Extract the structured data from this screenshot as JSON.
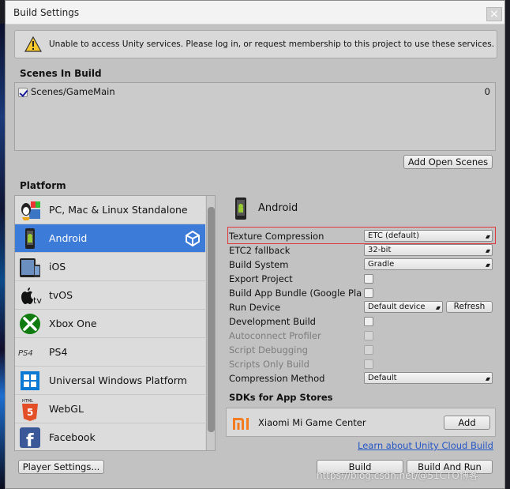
{
  "window": {
    "title": "Build Settings",
    "close_glyph": "×"
  },
  "warning": {
    "icon": "warning-triangle-icon",
    "message": "Unable to access Unity services. Please log in, or request membership to this project to use these services."
  },
  "scenes": {
    "header": "Scenes In Build",
    "items": [
      {
        "name": "Scenes/GameMain",
        "index": "0",
        "checked": true
      }
    ],
    "add_open_scenes_label": "Add Open Scenes"
  },
  "platform": {
    "header": "Platform",
    "items": [
      {
        "label": "PC, Mac & Linux Standalone",
        "icon": "standalone-icon",
        "selected": false
      },
      {
        "label": "Android",
        "icon": "android-icon",
        "selected": true
      },
      {
        "label": "iOS",
        "icon": "ios-icon",
        "selected": false
      },
      {
        "label": "tvOS",
        "icon": "tvos-icon",
        "selected": false
      },
      {
        "label": "Xbox One",
        "icon": "xbox-icon",
        "selected": false
      },
      {
        "label": "PS4",
        "icon": "ps4-icon",
        "selected": false
      },
      {
        "label": "Universal Windows Platform",
        "icon": "windows-icon",
        "selected": false
      },
      {
        "label": "WebGL",
        "icon": "html5-icon",
        "selected": false
      },
      {
        "label": "Facebook",
        "icon": "facebook-icon",
        "selected": false
      }
    ]
  },
  "selected_platform": {
    "title": "Android",
    "settings": {
      "texture_compression": {
        "label": "Texture Compression",
        "value": "ETC (default)"
      },
      "etc2_fallback": {
        "label": "ETC2 fallback",
        "value": "32-bit"
      },
      "build_system": {
        "label": "Build System",
        "value": "Gradle"
      },
      "export_project": {
        "label": "Export Project",
        "checked": false
      },
      "build_app_bundle": {
        "label": "Build App Bundle (Google Play)",
        "checked": false
      },
      "run_device": {
        "label": "Run Device",
        "value": "Default device",
        "refresh_label": "Refresh"
      },
      "development_build": {
        "label": "Development Build",
        "checked": false
      },
      "autoconnect_profiler": {
        "label": "Autoconnect Profiler",
        "checked": false,
        "enabled": false
      },
      "script_debugging": {
        "label": "Script Debugging",
        "checked": false,
        "enabled": false
      },
      "scripts_only_build": {
        "label": "Scripts Only Build",
        "checked": false,
        "enabled": false
      },
      "compression_method": {
        "label": "Compression Method",
        "value": "Default"
      }
    },
    "sdks": {
      "header": "SDKs for App Stores",
      "items": [
        {
          "name": "Xiaomi Mi Game Center",
          "icon": "xiaomi-mi-icon",
          "button_label": "Add"
        }
      ]
    },
    "cloud_link": "Learn about Unity Cloud Build"
  },
  "footer": {
    "player_settings_label": "Player Settings...",
    "build_label": "Build",
    "build_and_run_label": "Build And Run"
  },
  "watermark": "https://blog.csdn.net/@51CTO博客",
  "colors": {
    "window_bg": "#c2c2c2",
    "selection": "#3d7bd9",
    "highlight_border": "#e0353b",
    "link": "#2456c7"
  }
}
